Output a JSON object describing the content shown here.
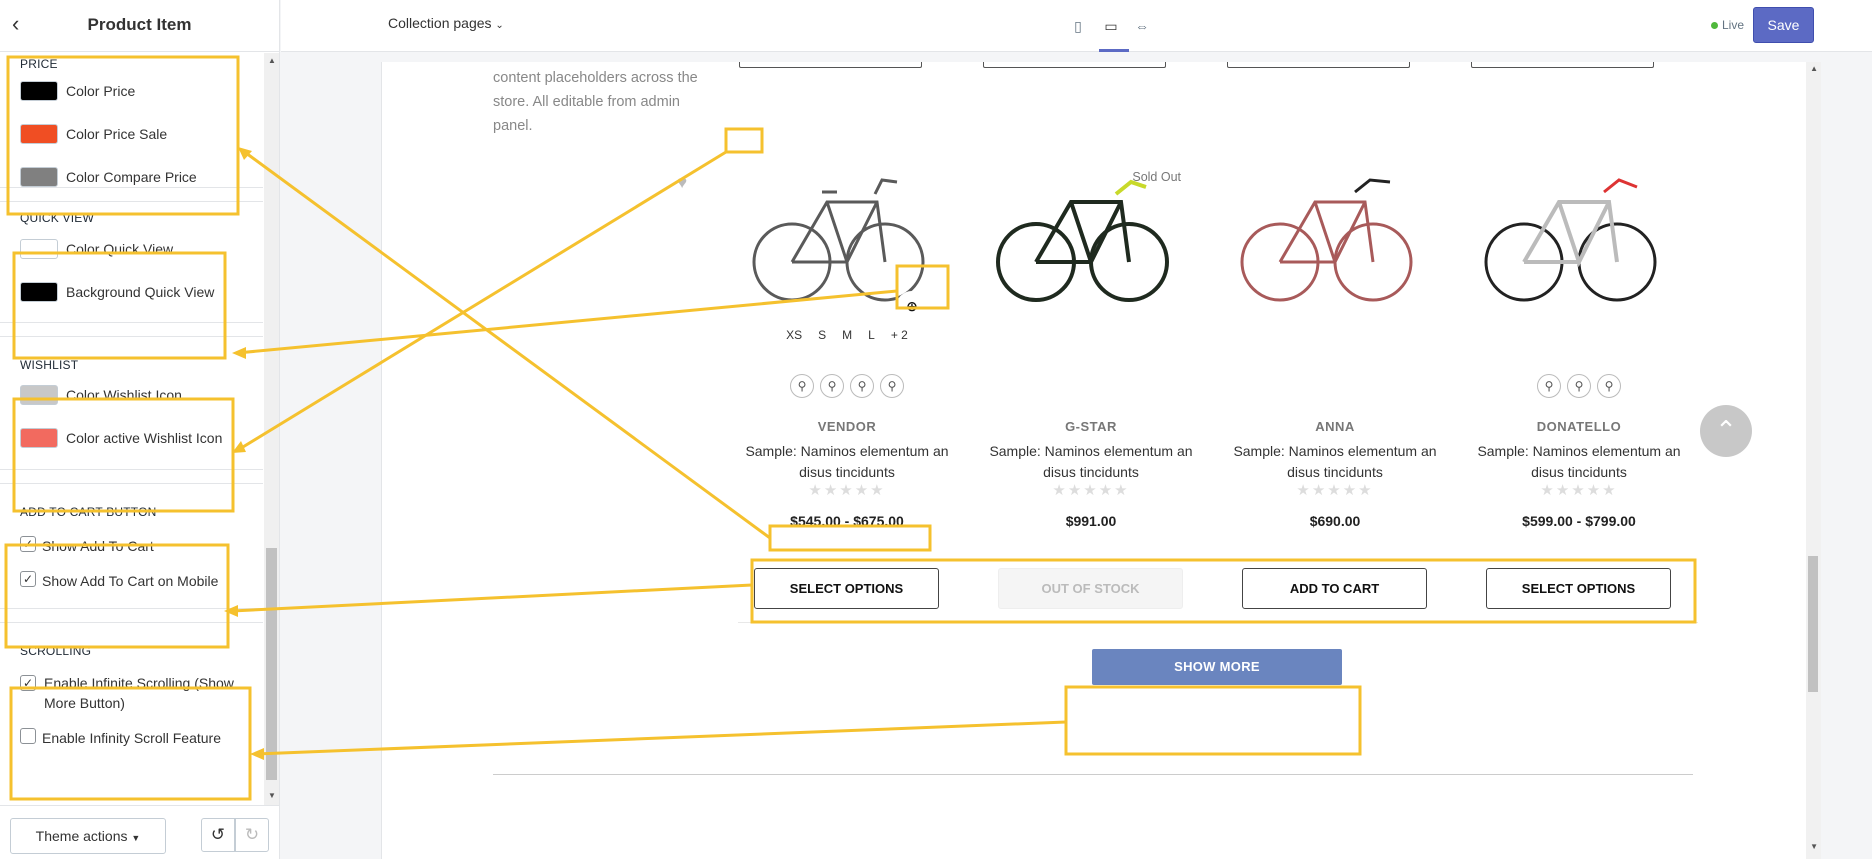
{
  "sidebar": {
    "title": "Product Item",
    "back_icon": "chevron-left-icon",
    "sections": {
      "price": {
        "heading": "PRICE",
        "rows": [
          {
            "label": "Color Price",
            "color": "#000000"
          },
          {
            "label": "Color Price Sale",
            "color": "#f04e23"
          },
          {
            "label": "Color Compare Price",
            "color": "#808080"
          }
        ]
      },
      "quickview": {
        "heading": "QUICK VIEW",
        "rows": [
          {
            "label": "Color Quick View",
            "color": "#ffffff"
          },
          {
            "label": "Background Quick View",
            "color": "#000000"
          }
        ]
      },
      "wishlist": {
        "heading": "WISHLIST",
        "rows": [
          {
            "label": "Color Wishlist Icon",
            "color": "#c8c8c8"
          },
          {
            "label": "Color active Wishlist Icon",
            "color": "#f26a5f"
          }
        ]
      },
      "addtocart": {
        "heading": "ADD TO CART BUTTON",
        "rows": [
          {
            "label": "Show Add To Cart",
            "checked": true
          },
          {
            "label": "Show Add To Cart on Mobile",
            "checked": true
          }
        ]
      },
      "scrolling": {
        "heading": "SCROLLING",
        "rows": [
          {
            "label": "Enable Infinite Scrolling (Show More Button)",
            "checked": true
          },
          {
            "label": "Enable Infinity Scroll Feature",
            "checked": false
          }
        ]
      }
    },
    "footer": {
      "theme_actions": "Theme actions",
      "undo_icon": "undo-icon",
      "redo_icon": "redo-icon"
    }
  },
  "topbar": {
    "collection": "Collection pages",
    "devices": [
      "mobile-icon",
      "desktop-icon",
      "fullscreen-icon"
    ],
    "live": "Live",
    "save": "Save"
  },
  "preview": {
    "intro": "content placeholders across the store. All editable from admin panel.",
    "products": [
      {
        "vendor": "VENDOR",
        "name": "Sample: Naminos elementum an disus tincidunts",
        "price": "$545.00 - $675.00",
        "cta": "SELECT OPTIONS",
        "sizes": [
          "XS",
          "S",
          "M",
          "L",
          "+ 2"
        ],
        "swatches": 4,
        "frame": "#5a5a5a"
      },
      {
        "vendor": "G-STAR",
        "name": "Sample: Naminos elementum an disus tincidunts",
        "price": "$991.00",
        "cta": "OUT OF STOCK",
        "sold_out": "Sold Out",
        "frame": "#1f2a1f"
      },
      {
        "vendor": "ANNA",
        "name": "Sample: Naminos elementum an disus tincidunts",
        "price": "$690.00",
        "cta": "ADD TO CART",
        "frame": "#a85a5a"
      },
      {
        "vendor": "DONATELLO",
        "name": "Sample: Naminos elementum an disus tincidunts",
        "price": "$599.00 - $799.00",
        "cta": "SELECT OPTIONS",
        "swatches": 3,
        "frame": "#d8d8d8"
      }
    ],
    "show_more": "SHOW MORE",
    "annotation_color": "#f5c12e"
  }
}
